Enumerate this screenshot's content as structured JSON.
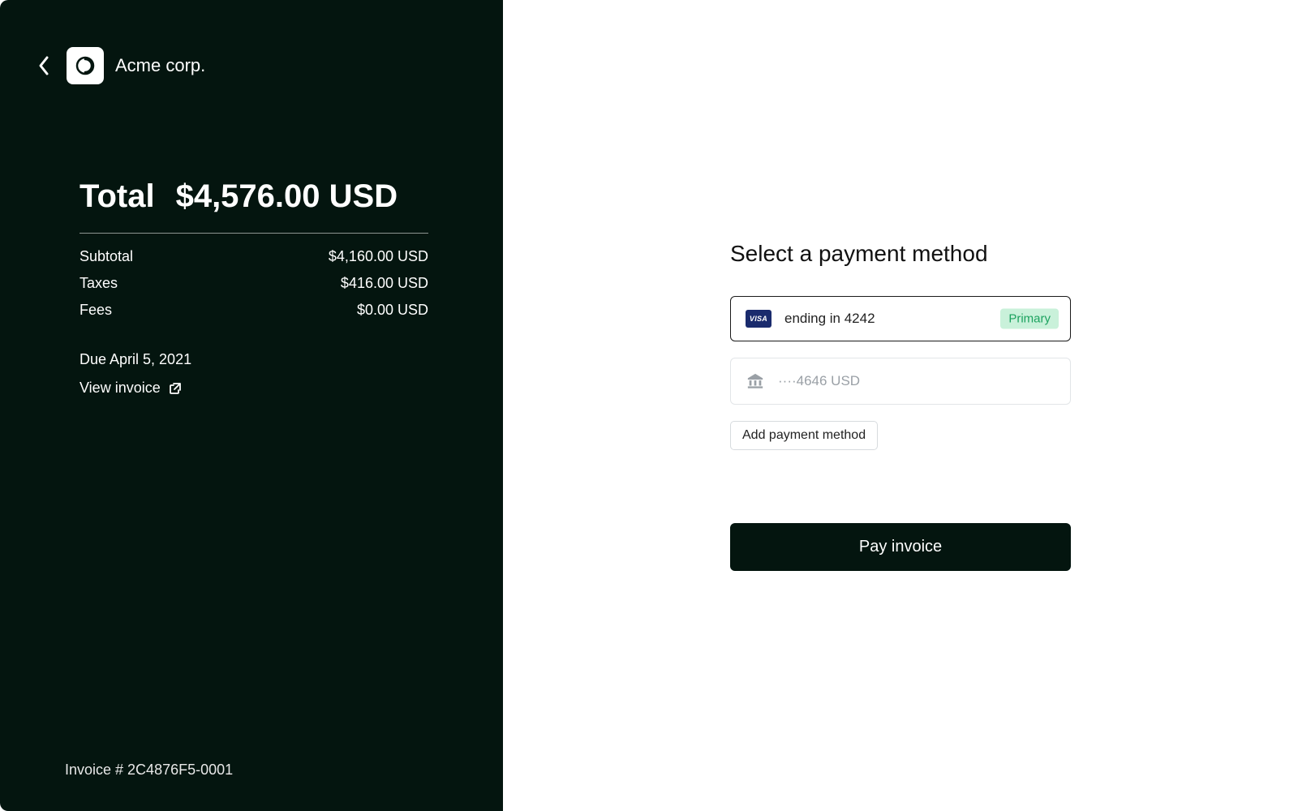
{
  "company": {
    "name": "Acme corp."
  },
  "summary": {
    "total_label": "Total",
    "total_amount": "$4,576.00 USD",
    "lines": [
      {
        "label": "Subtotal",
        "value": "$4,160.00 USD"
      },
      {
        "label": "Taxes",
        "value": "$416.00 USD"
      },
      {
        "label": "Fees",
        "value": "$0.00 USD"
      }
    ],
    "due": "Due April 5, 2021",
    "view_invoice": "View invoice"
  },
  "invoice_footer": "Invoice # 2C4876F5-0001",
  "payment": {
    "title": "Select a payment method",
    "methods": [
      {
        "brand": "VISA",
        "text": "ending in 4242",
        "primary_label": "Primary"
      },
      {
        "brand": "bank",
        "text": "····4646 USD"
      }
    ],
    "add_label": "Add payment method",
    "pay_label": "Pay invoice"
  }
}
